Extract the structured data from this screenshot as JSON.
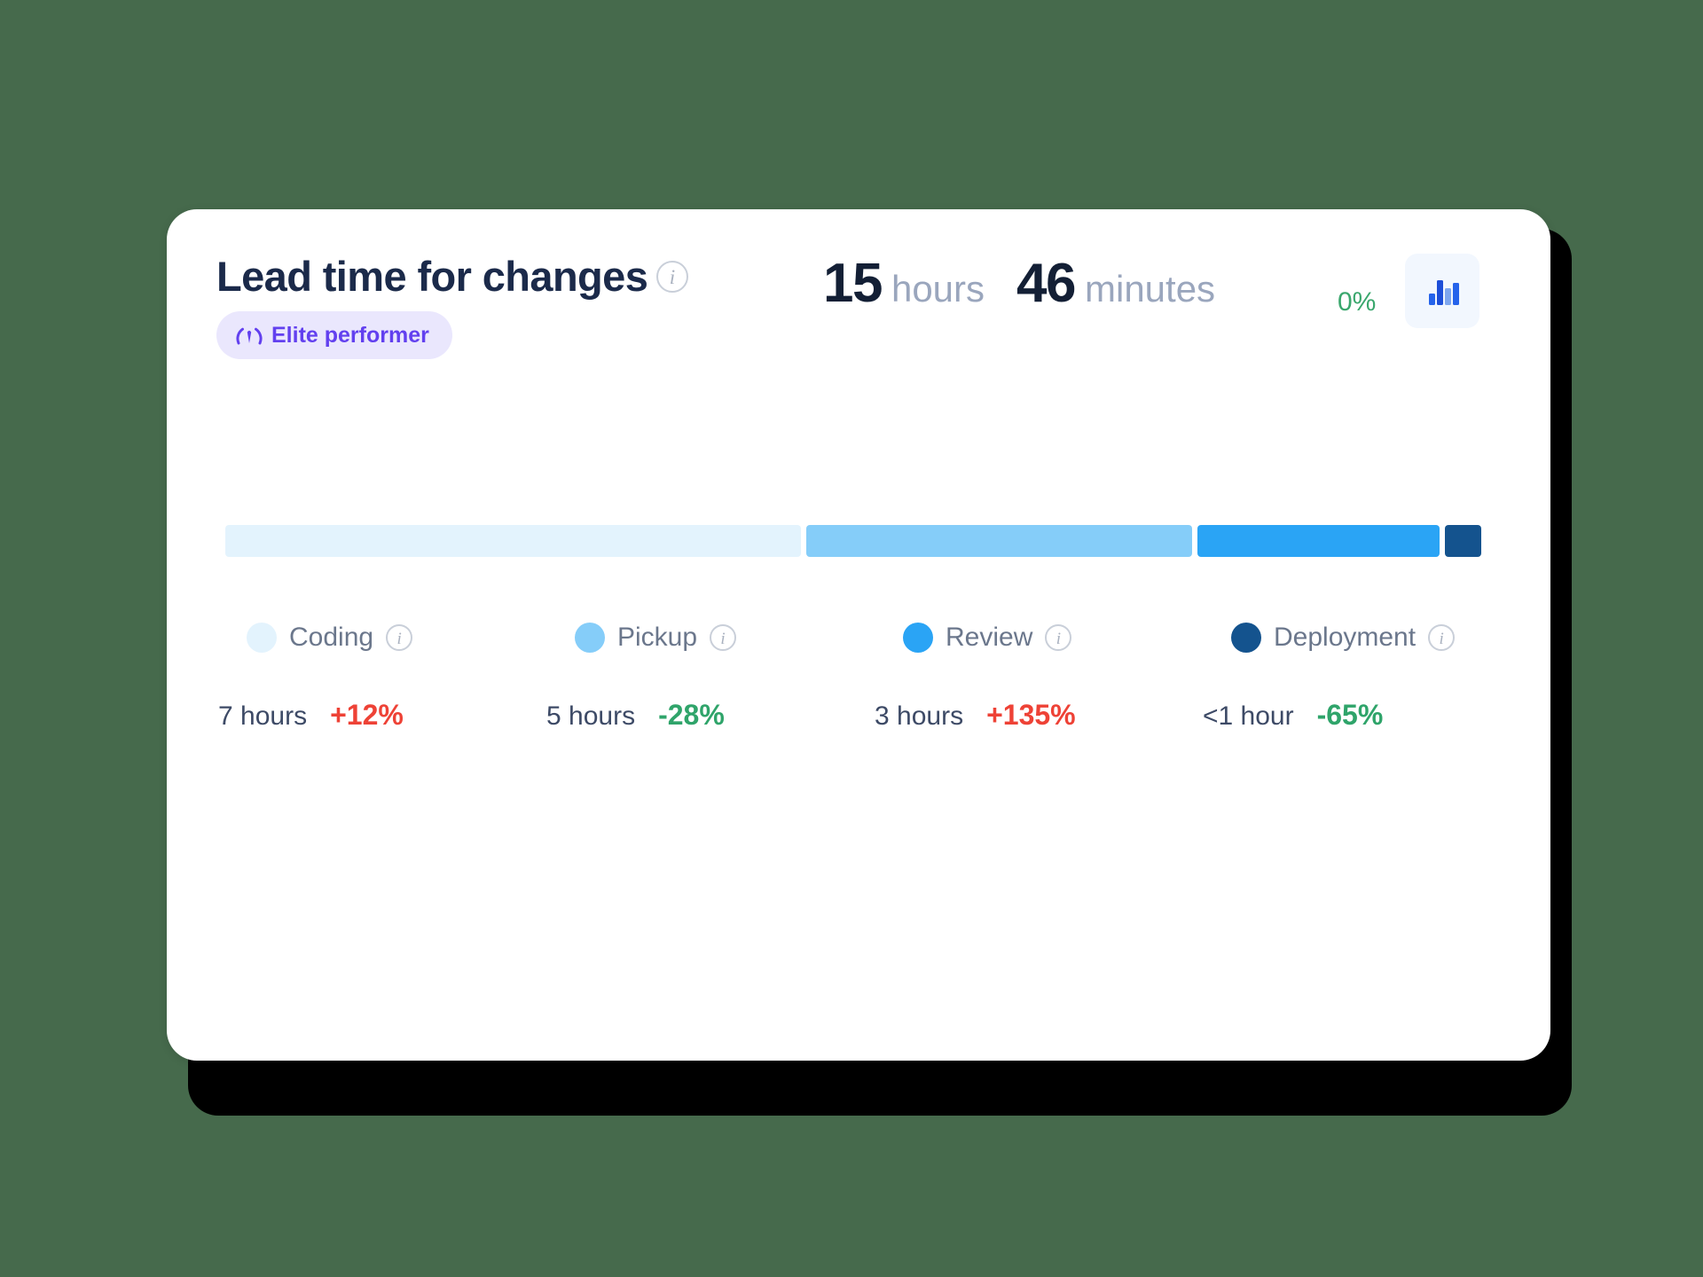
{
  "card": {
    "title": "Lead time for changes",
    "title_info_icon": "info-icon",
    "badge": {
      "label": "Elite performer",
      "icon": "gauge-icon",
      "text_color": "#6240ef",
      "background_color": "#eae7fd"
    },
    "metric": {
      "primary_number": "15",
      "primary_unit": "hours",
      "secondary_number": "46",
      "secondary_unit": "minutes",
      "delta": "0%",
      "delta_color": "#3aa76d"
    },
    "chart_toggle": {
      "icon": "bar-chart-icon",
      "background_color": "#f2f7fe",
      "icon_color": "#2563eb"
    }
  },
  "chart_data": {
    "type": "bar",
    "title": "Lead time for changes",
    "subtitle": "15 hours 46 minutes",
    "orientation": "horizontal-stacked",
    "categories": [
      "Coding",
      "Pickup",
      "Review",
      "Deployment"
    ],
    "values": [
      7,
      5,
      3,
      0.5
    ],
    "value_labels": [
      "7 hours",
      "5 hours",
      "3 hours",
      "<1 hour"
    ],
    "percent_of_total": [
      44.0,
      29.5,
      18.5,
      2.8
    ],
    "changes": [
      "+12%",
      "-28%",
      "+135%",
      "-65%"
    ],
    "change_directions": [
      "up",
      "down",
      "up",
      "down"
    ],
    "colors": [
      "#e3f3fd",
      "#85cdf9",
      "#2aa4f5",
      "#14538e"
    ],
    "xlabel": "",
    "ylabel": "",
    "grid": false,
    "legend_position": "bottom"
  },
  "legend": [
    {
      "label": "Coding",
      "color": "#e3f3fd",
      "info_icon": "info-icon",
      "duration": "7 hours",
      "change": "+12%"
    },
    {
      "label": "Pickup",
      "color": "#85cdf9",
      "info_icon": "info-icon",
      "duration": "5 hours",
      "change": "-28%"
    },
    {
      "label": "Review",
      "color": "#2aa4f5",
      "info_icon": "info-icon",
      "duration": "3 hours",
      "change": "+135%"
    },
    {
      "label": "Deployment",
      "color": "#14538e",
      "info_icon": "info-icon",
      "duration": "<1 hour",
      "change": "-65%"
    }
  ],
  "theme": {
    "page_background": "#466a4c",
    "card_background": "#ffffff",
    "positive_change_color": "#ee4236",
    "negative_change_color": "#2fa46a"
  }
}
